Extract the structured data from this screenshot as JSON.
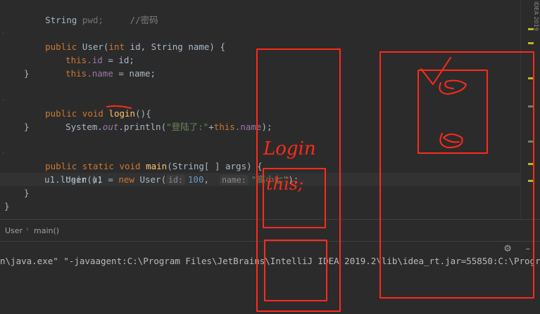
{
  "editor": {
    "lines": {
      "l1_type": "String",
      "l1_field": "pwd;",
      "l1_comment": "//密码",
      "l2_public": "public",
      "l2_sig": "User(",
      "l2_int": "int",
      "l2_rest": "id, String name) {",
      "l3_this": "this",
      "l3_field": ".id",
      "l3_rest": " = id;",
      "l4_this": "this",
      "l4_field": ".name",
      "l4_rest": " = name;",
      "l5": "}",
      "l6_kw": "public void",
      "l6_fn": "login",
      "l6_rest": "(){",
      "l7_sys": "System.",
      "l7_out": "out",
      "l7_print": ".println(",
      "l7_str": "\"登陆了:\"",
      "l7_plus": "+",
      "l7_this": "this",
      "l7_field": ".name",
      "l7_end": ");",
      "l8": "}",
      "l9_kw": "public static void",
      "l9_fn": "main",
      "l9_rest": "(String[ ] args) {",
      "l10_type": "User u1 = ",
      "l10_new": "new",
      "l10_ctor": " User(",
      "l10_hint_id": "id:",
      "l10_num": "100",
      "l10_comma": ",",
      "l10_hint_name": "name:",
      "l10_str": "\"高小七\"",
      "l10_end": ");",
      "l11": "u1.login();",
      "l12": "}",
      "l13": "}"
    },
    "scrollbar_label": "IDEA 2019"
  },
  "breadcrumb": {
    "class": "User",
    "method": "main()"
  },
  "tool_icons": [
    "gear-icon",
    "minimize-icon"
  ],
  "console": {
    "line": "n\\java.exe\" \"-javaagent:C:\\Program Files\\JetBrains\\IntelliJ IDEA 2019.2\\lib\\idea_rt.jar=55850:C:\\Progra"
  },
  "annotations": {
    "handwriting_1": "Login",
    "handwriting_2": "this;",
    "ink_color": "#ff2a1a"
  }
}
